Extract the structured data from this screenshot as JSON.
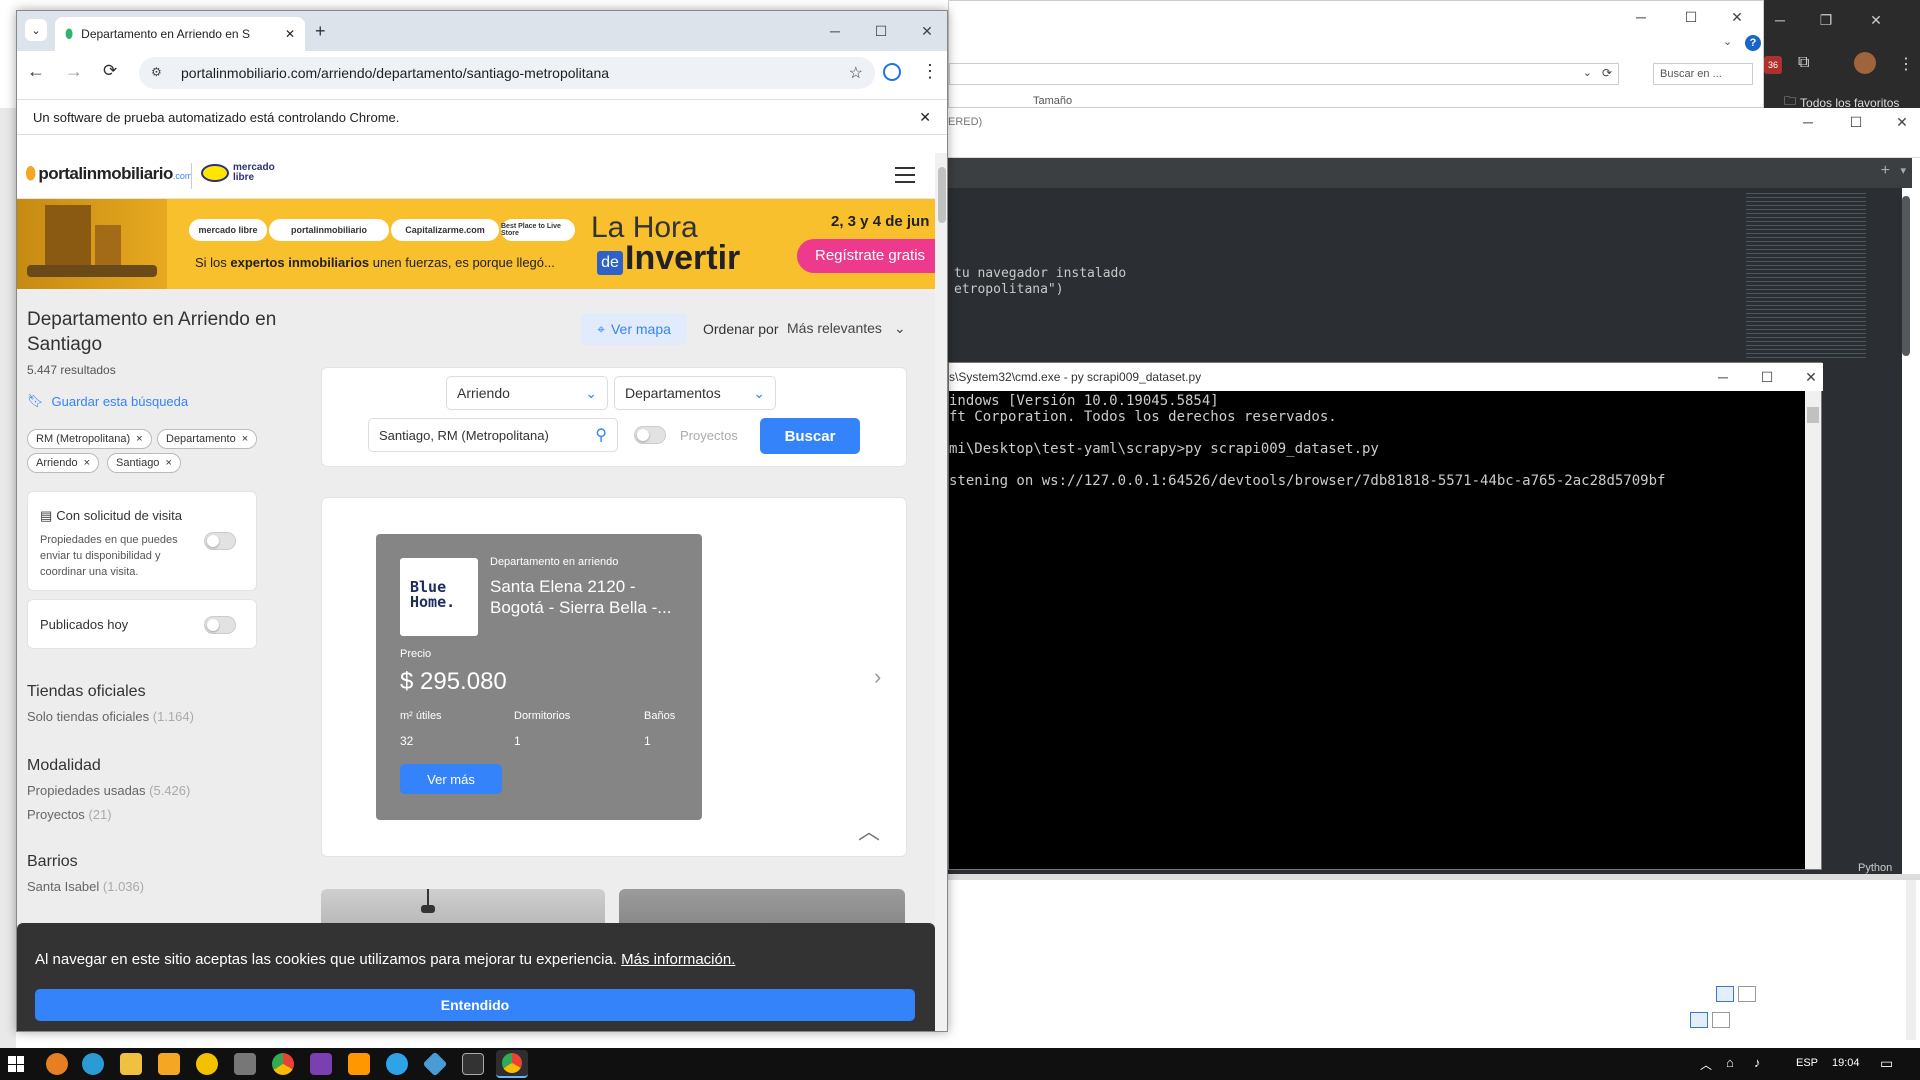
{
  "chrome": {
    "tab_title": "Departamento en Arriendo en S",
    "url": "portalinmobiliario.com/arriendo/departamento/santiago-metropolitana",
    "infobar_text": "Un software de prueba automatizado está controlando Chrome."
  },
  "explorer": {
    "search_placeholder": "Buscar en ...",
    "column_size": "Tamaño",
    "favorites_label": "Todos los favoritos"
  },
  "editor": {
    "title_fragment": "ERED)",
    "code_line1": "tu navegador instalado",
    "code_line2": "etropolitana\")",
    "status_lang": "Python"
  },
  "cmd": {
    "title": "s\\System32\\cmd.exe - py  scrapi009_dataset.py",
    "lines": [
      "indows [Versión 10.0.19045.5854]",
      "ft Corporation. Todos los derechos reservados.",
      "",
      "mi\\Desktop\\test-yaml\\scrapy>py scrapi009_dataset.py",
      "",
      "stening on ws://127.0.0.1:64526/devtools/browser/7db81818-5571-44bc-a765-2ac28d5709bf"
    ]
  },
  "site": {
    "logo_text": "portalinmobiliario",
    "logo_suffix": ".com",
    "ml_logo": "mercado libre",
    "banner": {
      "pills": [
        "mercado libre",
        "portalinmobiliario",
        "Capitalizarme.com",
        "Best Place to Live Store"
      ],
      "tagline_pre": "Si los ",
      "tagline_bold": "expertos inmobiliarios",
      "tagline_post": " unen fuerzas, es porque llegó...",
      "hora_line1": "La Hora",
      "hora_de": "de",
      "hora_line2": "Invertir",
      "dates": "2, 3 y 4 de jun",
      "cta": "Regístrate gratis"
    },
    "page_title": "Departamento en Arriendo en Santiago",
    "results": "5.447 resultados",
    "save_search": "Guardar esta búsqueda",
    "chips": [
      "RM (Metropolitana)",
      "Departamento",
      "Arriendo",
      "Santiago"
    ],
    "map_button": "Ver mapa",
    "sort_label": "Ordenar por",
    "sort_value": "Más relevantes",
    "search": {
      "operation": "Arriendo",
      "type": "Departamentos",
      "location": "Santiago, RM (Metropolitana)",
      "projects": "Proyectos",
      "button": "Buscar"
    },
    "filter_visit_title": "Con solicitud de visita",
    "filter_visit_desc": "Propiedades en que puedes enviar tu disponibilidad y coordinar una visita.",
    "filter_today": "Publicados hoy",
    "sections": {
      "tiendas_title": "Tiendas oficiales",
      "tiendas_item": "Solo tiendas oficiales",
      "tiendas_count": "(1.164)",
      "modalidad_title": "Modalidad",
      "modalidad_item1": "Propiedades usadas",
      "modalidad_count1": "(5.426)",
      "modalidad_item2": "Proyectos",
      "modalidad_count2": "(21)",
      "barrios_title": "Barrios",
      "barrios_item": "Santa Isabel",
      "barrios_count": "(1.036)"
    },
    "featured": {
      "brand_line1": "Blue",
      "brand_line2": "Home.",
      "category": "Departamento en arriendo",
      "title": "Santa Elena 2120 - Bogotá - Sierra Bella -...",
      "price_label": "Precio",
      "price": "$ 295.080",
      "col1_label": "m² útiles",
      "col2_label": "Dormitorios",
      "col3_label": "Baños",
      "col1_value": "32",
      "col2_value": "1",
      "col3_value": "1",
      "button": "Ver más"
    },
    "cookie": {
      "text": "Al navegar en este sitio aceptas las cookies que utilizamos para mejorar tu experiencia.",
      "link": "Más información.",
      "button": "Entendido"
    }
  },
  "taskbar": {
    "lang": "ESP",
    "time": "19:04"
  }
}
